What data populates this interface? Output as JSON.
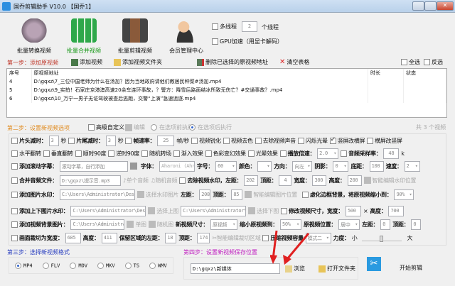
{
  "window": {
    "title": "国乔剪辑助手 V10.0 【国乔1】"
  },
  "toolbar": {
    "items": [
      {
        "label": "批量转换视频"
      },
      {
        "label": "批量合并视频"
      },
      {
        "label": "批量剪辑视频"
      },
      {
        "label": "会员管理中心"
      }
    ],
    "multithread_label": "多线程",
    "thread_count": "2",
    "thread_unit": "个线程",
    "gpu_label": "GPU加速（用显卡解码）"
  },
  "step1": {
    "title": "第一步：添加原视频",
    "add_video": "添加视频",
    "add_folder": "添加视频文件夹",
    "delete_selected": "删除已选择的原视频地址",
    "clear_table": "清空表格",
    "select_all": "全选",
    "invert": "反选"
  },
  "table": {
    "headers": [
      "序号",
      "原视频地址",
      "时长",
      "状态"
    ],
    "rows": [
      {
        "no": "4",
        "path": "D:\\gqxz\\7_三位中国老师为什么在汤加？因为当地政府请他们教居民种菜#汤加.mp4"
      },
      {
        "no": "5",
        "path": "D:\\gqxz\\9_实拍！石家庄京港澳高速20余车连环事故，？警方：降雪后路面结冰所致无伤亡？#交通事故？.mp4"
      },
      {
        "no": "6",
        "path": "D:\\gqxz\\10_万宁一男子无证驾驶被查后逃跑，交警“上演”急速追逐.mp4"
      }
    ]
  },
  "step2": {
    "title": "第二步：设置新视频选项",
    "advanced": "高级自定义",
    "edit": "编辑",
    "before": "在选项前执行",
    "after": "在选项后执行",
    "count": "共 3 个视频"
  },
  "opts": {
    "head_cut": "片头减时：",
    "head_val": "3",
    "sec": "秒",
    "tail_cut": "片尾减时：",
    "tail_val": "3",
    "fps": "帧速率：",
    "fps_val": "25",
    "fps_unit": "帧/秒",
    "sharpen": "视频锐化",
    "decolor": "视频去色",
    "mute": "去除视频声音",
    "flash": "闪烁光晕",
    "v2h": "竖屏改横屏",
    "h2v": "横屏改竖屏",
    "hflip": "水平翻转",
    "vflip": "垂直翻转",
    "cw90": "顺时90度",
    "ccw90": "逆时90度",
    "rand_trans": "随机转场",
    "fadein": "渐入效果",
    "color_fx": "色彩变幻效果",
    "halo": "光晕效果",
    "speed": "播放倍速：",
    "speed_val": "2.0",
    "sample": "音频采样率：",
    "sample_val": "48",
    "sample_unit": "k",
    "scroll_sub": "添加滚动字幕：",
    "scroll_text": "滚动字幕，自行添加",
    "font": "字体：",
    "font_val": "Aharoni (Ahr:",
    "size": "字号：",
    "size_val": "60",
    "color": "颜色：",
    "dir": "方向：",
    "dir_val": "向左",
    "shadow": "阴影：",
    "shadow_val": "0",
    "bottom": "底距：",
    "bottom_val": "100",
    "spd": "速度：",
    "spd_val": "2",
    "merge_audio": "合并音频文件：",
    "audio_path": "D:\\gqxz\\提示音.mp3",
    "single_audio": "单个音频",
    "rand_audio": "随机音频",
    "remove_wm": "去除视频水印，左距：",
    "rm_left": "202",
    "top": "顶距：",
    "rm_top": "4",
    "width": "宽度：",
    "rm_w": "300",
    "height": "高度：",
    "rm_h": "200",
    "smart_wm": "智能编辑水印位置",
    "img_wm": "添加图片水印：",
    "img_path": "C:\\Users\\Administrator\\Desktop\\img-q",
    "choose_wm": "选择水印图片",
    "left": "左距：",
    "img_left": "208",
    "img_top": "85",
    "smart_img": "智能编辑图片位置",
    "blur_border": "虚化边框背景，将原视频缩小到：",
    "blur_val": "90%",
    "tb_wm": "添加上下图片水印：",
    "tb_path1": "C:\\Users\\Administrator\\Desktop\\i",
    "choose_top": "选择上图",
    "tb_path2": "C:\\Users\\Administrator\\Desk",
    "choose_bottom": "选择下图",
    "resize": "修改视频尺寸，宽度：",
    "resize_w": "500",
    "times": "×",
    "height2": "高度：",
    "resize_h": "700",
    "bg_img": "添加视频背景图片：",
    "bg_path": "C:\\Users\\Administrator\\D",
    "single_img": "单图",
    "rand_img": "随机图",
    "new_size": "新视频尺寸：",
    "new_size_val": "原视频",
    "shrink": "缩小原视频到：",
    "shrink_val": "50%",
    "pos": "原视频位置：",
    "pos_val": "居中",
    "pos_left": "0",
    "pos_top": "0",
    "crop": "画面裁切为宽度：",
    "crop_w": "685",
    "crop_h": "411",
    "keep_left": "保留区域的左距：",
    "crop_left": "18",
    "crop_top": "174",
    "smart_crop": "智能编辑裁切区域",
    "compress": "压缩视频容量",
    "mode_val": "模式二",
    "strength": "力度：",
    "small": "小",
    "big": "大",
    "strength_level": 0.5
  },
  "step3": {
    "title": "第三步：选择新视频格式",
    "formats": [
      "MP4",
      "FLV",
      "MOV",
      "MKV",
      "TS",
      "WMV"
    ],
    "selected": "MP4"
  },
  "step4": {
    "title": "第四步：设置新视频保存位置",
    "path": "D:\\gqxz\\新媒体",
    "browse": "浏览",
    "open_folder": "打开文件夹",
    "start": "开始剪辑"
  },
  "colors": {
    "step1": "#c0392b",
    "step2": "#e08a1e",
    "step3": "#2a3fc0",
    "step4": "#c020c0",
    "green": "#1a9a1a"
  }
}
